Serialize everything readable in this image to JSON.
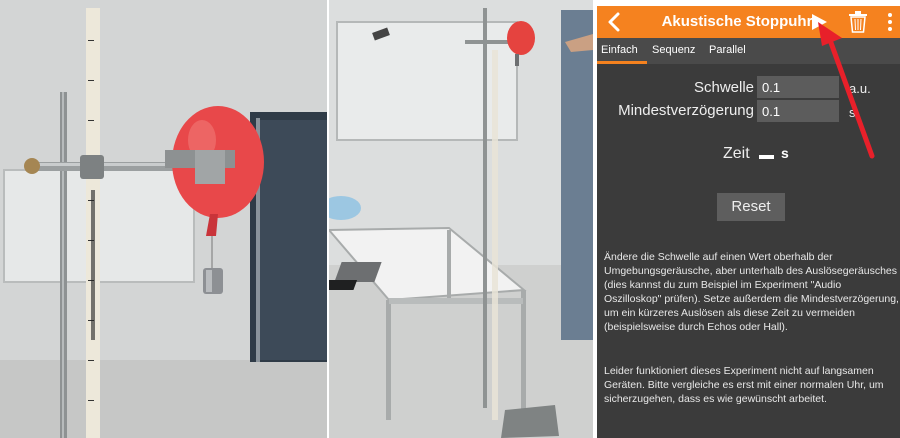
{
  "app": {
    "title": "Akustische Stoppuhr",
    "accent_color": "#f5821f",
    "icons": [
      "chevron-left-icon",
      "play-icon",
      "trash-icon",
      "more-vert-icon"
    ]
  },
  "tabs": [
    "Einfach",
    "Sequenz",
    "Parallel"
  ],
  "active_tab": "Einfach",
  "threshold": {
    "label": "Schwelle",
    "value": "0.1",
    "unit": "a.u."
  },
  "min_delay": {
    "label": "Mindestverzögerung",
    "value": "0.1",
    "unit": "s"
  },
  "time": {
    "label": "Zeit",
    "value": "–",
    "unit": "s"
  },
  "reset_label": "Reset",
  "help": {
    "paragraph1": "Ändere die Schwelle auf einen Wert oberhalb der Umgebungsgeräusche, aber unterhalb des Auslösegeräusches (dies kannst du zum Beispiel im Experiment \"Audio Oszilloskop\" prüfen). Setze außerdem die Mindestverzögerung, um ein kürzeres Auslösen als diese Zeit zu vermeiden (beispielsweise durch Echos oder Hall).",
    "paragraph2": "Leider funktioniert dieses Experiment nicht auf langsamen Geräten. Bitte vergleiche es erst mit einer normalen Uhr, um sicherzugehen, dass es wie gewünscht arbeitet."
  },
  "annotation_color": "#e8202a"
}
